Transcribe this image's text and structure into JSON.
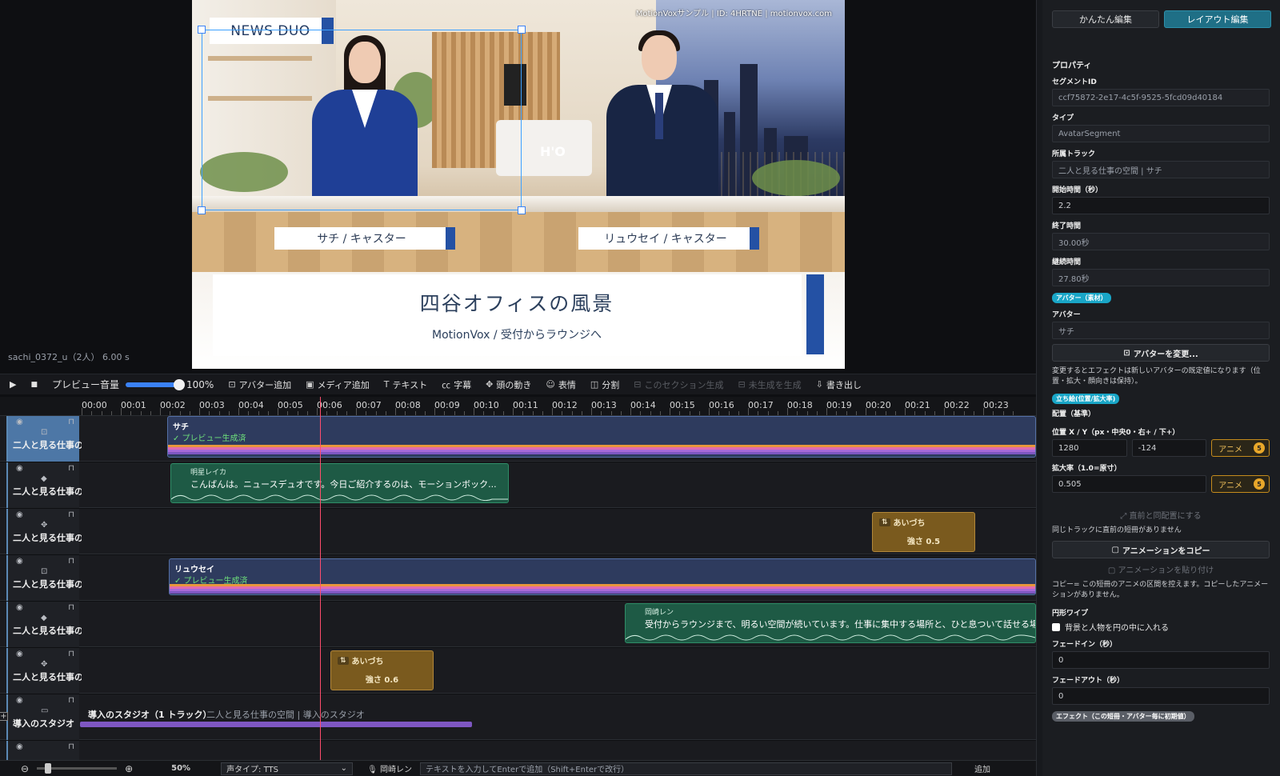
{
  "preview": {
    "watermark": "MotionVoxサンプル | ID: 4HRTNE | motionvox.com",
    "news_tag": "NEWS DUO",
    "left_name": "サチ / キャスター",
    "right_name": "リュウセイ / キャスター",
    "caption_title": "四谷オフィスの風景",
    "caption_sub": "MotionVox / 受付からラウンジへ",
    "logo": "H'O",
    "info": "sachi_0372_u（2人） 6.00 s"
  },
  "toolbar": {
    "play_icon": "▶",
    "stop_icon": "■",
    "volume_label": "プレビュー音量",
    "volume_value": "100%",
    "add_avatar": "アバター追加",
    "add_media": "メディア追加",
    "text": "テキスト",
    "subtitle": "字幕",
    "head_motion": "頭の動き",
    "expression": "表情",
    "split": "分割",
    "section_generate": "このセクション生成",
    "ungenerated": "未生成を生成",
    "export": "書き出し"
  },
  "ruler": [
    "00:00",
    "00:01",
    "00:02",
    "00:03",
    "00:04",
    "00:05",
    "00:06",
    "00:07",
    "00:08",
    "00:09",
    "00:10",
    "00:11",
    "00:12",
    "00:13",
    "00:14",
    "00:15",
    "00:16",
    "00:17",
    "00:18",
    "00:19",
    "00:20",
    "00:21",
    "00:22",
    "00:23"
  ],
  "tracks": {
    "t1_name": "二人と見る仕事の...",
    "t2_name": "二人と見る仕事の...",
    "t3_name": "二人と見る仕事の...",
    "t4_name": "二人と見る仕事の...",
    "t5_name": "二人と見る仕事の...",
    "t6_name": "二人と見る仕事の...",
    "t7_name": "導入のスタジオ",
    "clip_sachi_title": "サチ",
    "clip_sachi_status": "✓ プレビュー生成済",
    "speech1_speaker": "明星レイカ",
    "speech1_text": "こんばんは。ニュースデュオです。今日ご紹介するのは、モーションボック...",
    "anim1_title": "あいづち",
    "anim1_strength": "強さ 0.5",
    "clip_ryusei_title": "リュウセイ",
    "clip_ryusei_status": "✓ プレビュー生成済",
    "speech2_speaker": "岡崎レン",
    "speech2_text": "受付からラウンジまで、明るい空間が続いています。仕事に集中する場所と、ひと息ついて話せる場所。使い",
    "anim2_title": "あいづち",
    "anim2_strength": "強さ 0.6",
    "group_title": "導入のスタジオ（1 トラック）",
    "group_sub": "二人と見る仕事の空間 | 導入のスタジオ"
  },
  "bottom": {
    "zoom": "50%",
    "voice_type": "声タイプ: TTS",
    "speaker": "岡崎レン",
    "placeholder": "テキストを入力してEnterで追加（Shift+Enterで改行）",
    "add": "追加"
  },
  "panel": {
    "tab_easy": "かんたん編集",
    "tab_layout": "レイアウト編集",
    "properties": "プロパティ",
    "segment_id_label": "セグメントID",
    "segment_id": "ccf75872-2e17-4c5f-9525-5fcd09d40184",
    "type_label": "タイプ",
    "type": "AvatarSegment",
    "track_label": "所属トラック",
    "track": "二人と見る仕事の空間 | サチ",
    "start_label": "開始時間（秒）",
    "start": "2.2",
    "end_label": "終了時間",
    "end": "30.00秒",
    "duration_label": "継続時間",
    "duration": "27.80秒",
    "tag_avatar": "アバター（素材）",
    "avatar_label": "アバター",
    "avatar": "サチ",
    "change_avatar": "アバターを変更...",
    "change_note": "変更するとエフェクトは新しいアバターの既定値になります（位置・拡大・顔向きは保持）。",
    "tag_pose": "立ち絵(位置/拡大率)",
    "placement_label": "配置（基準）",
    "pos_label": "位置 X / Y（px・中央0・右+ / 下+）",
    "pos_x": "1280",
    "pos_y": "-124",
    "anime_label": "アニメ",
    "anime_count": "5",
    "scale_label": "拡大率（1.0=原寸）",
    "scale": "0.505",
    "same_as_prev": "直前と同配置にする",
    "no_prev_note": "同じトラックに直前の短冊がありません",
    "copy_anim": "アニメーションをコピー",
    "paste_anim": "アニメーションを貼り付け",
    "copy_note": "コピー= この短冊のアニメの区間を控えます。コピーしたアニメーションがありません。",
    "wipe_label": "円形ワイプ",
    "wipe_check": "背景と人物を円の中に入れる",
    "fadein_label": "フェードイン（秒）",
    "fadein": "0",
    "fadeout_label": "フェードアウト（秒）",
    "fadeout": "0",
    "tag_effect": "エフェクト（この短冊・アバター毎に初期値）"
  }
}
